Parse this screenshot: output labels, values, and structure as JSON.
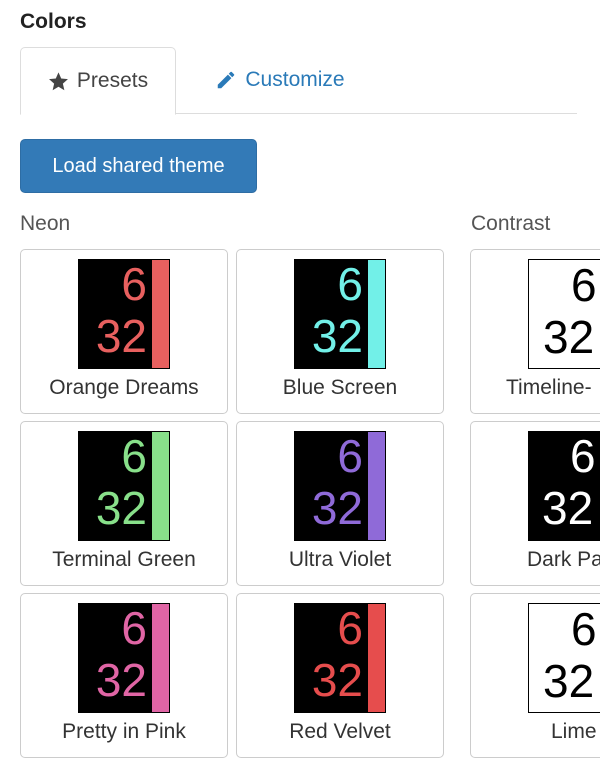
{
  "section": {
    "title": "Colors"
  },
  "tabs": [
    {
      "label": "Presets",
      "icon": "star-icon",
      "active": true
    },
    {
      "label": "Customize",
      "icon": "pencil-icon",
      "active": false
    }
  ],
  "load_button": {
    "label": "Load shared theme",
    "color": "#337ab7"
  },
  "groups": {
    "neon": {
      "label": "Neon",
      "themes": [
        {
          "name": "Orange Dreams",
          "top": "6",
          "bottom": "32",
          "color": "#e8605f"
        },
        {
          "name": "Blue Screen",
          "top": "6",
          "bottom": "32",
          "color": "#72f0e8"
        },
        {
          "name": "Terminal Green",
          "top": "6",
          "bottom": "32",
          "color": "#88e08a"
        },
        {
          "name": "Ultra Violet",
          "top": "6",
          "bottom": "32",
          "color": "#8f6ad8"
        },
        {
          "name": "Pretty in Pink",
          "top": "6",
          "bottom": "32",
          "color": "#e065a5"
        },
        {
          "name": "Red Velvet",
          "top": "6",
          "bottom": "32",
          "color": "#e64d4d"
        }
      ]
    },
    "contrast": {
      "label": "Contrast",
      "themes": [
        {
          "name": "Timeline-",
          "top": "6",
          "bottom": "32",
          "style": "light"
        },
        {
          "name": "Dark Pa",
          "top": "6",
          "bottom": "32",
          "style": "dark"
        },
        {
          "name": "Lime",
          "top": "6",
          "bottom": "32",
          "style": "light"
        }
      ]
    }
  }
}
